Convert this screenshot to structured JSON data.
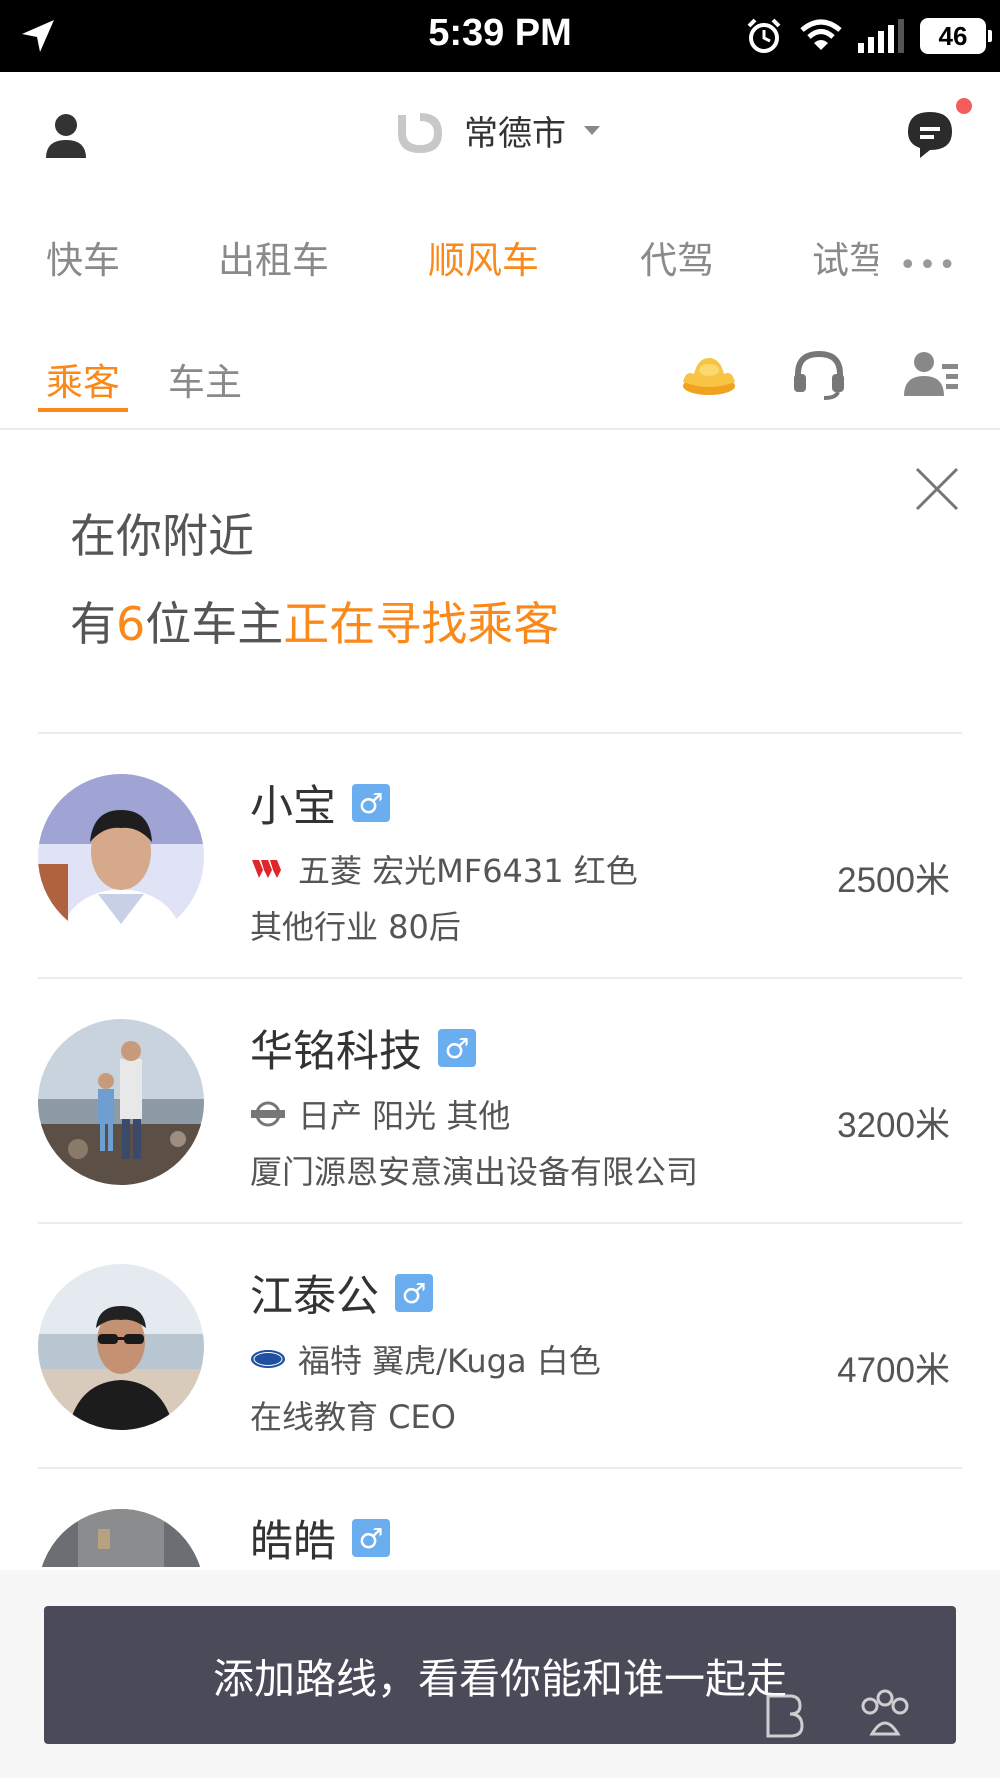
{
  "status_bar": {
    "time": "5:39 PM",
    "battery": "46"
  },
  "header": {
    "city": "常德市"
  },
  "service_tabs": [
    {
      "label": "快车"
    },
    {
      "label": "出租车"
    },
    {
      "label": "顺风车",
      "active": true
    },
    {
      "label": "代驾"
    },
    {
      "label": "试驾"
    }
  ],
  "role_tabs": [
    {
      "label": "乘客",
      "active": true
    },
    {
      "label": "车主"
    }
  ],
  "banner": {
    "line1": "在你附近",
    "line2_prefix": "有",
    "line2_count": "6",
    "line2_mid": "位车主",
    "line2_highlight": "正在寻找乘客"
  },
  "drivers": [
    {
      "name": "小宝",
      "gender": "♂",
      "car": "五菱 宏光MF6431 红色",
      "job": "其他行业 80后",
      "distance": "2500米",
      "brand_icon": "wuling-logo-icon"
    },
    {
      "name": "华铭科技",
      "gender": "♂",
      "car": "日产 阳光 其他",
      "job": "厦门源恩安意演出设备有限公司",
      "distance": "3200米",
      "brand_icon": "nissan-logo-icon"
    },
    {
      "name": "江泰公",
      "gender": "♂",
      "car": "福特 翼虎/Kuga 白色",
      "job": "在线教育 CEO",
      "distance": "4700米",
      "brand_icon": "ford-logo-icon"
    },
    {
      "name": "皓皓",
      "gender": "♂"
    }
  ],
  "bottom_button": {
    "label": "添加路线，看看你能和谁一起走"
  },
  "colors": {
    "accent": "#fa8919",
    "gender_badge": "#6aaef0",
    "button_bg": "#4a4a58"
  }
}
